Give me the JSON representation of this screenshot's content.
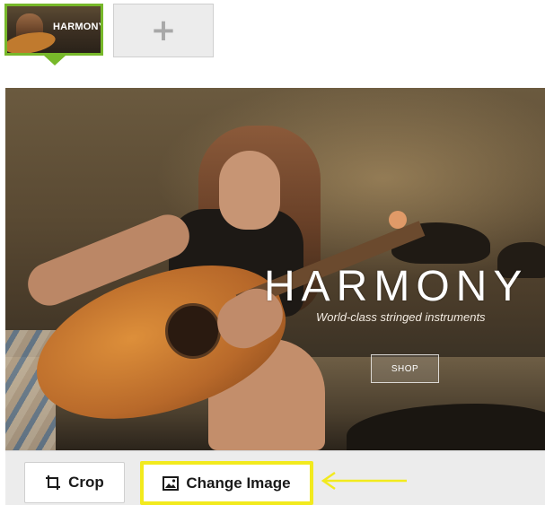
{
  "thumbnails": [
    {
      "title": "HARMONY",
      "selected": true
    }
  ],
  "add_slide": {
    "icon": "plus-icon",
    "label": "+"
  },
  "hero": {
    "brand": "HARMONY",
    "tagline": "World-class stringed instruments",
    "cta_label": "SHOP"
  },
  "toolbar": {
    "crop": {
      "icon": "crop-icon",
      "label": "Crop"
    },
    "change_image": {
      "icon": "image-icon",
      "label": "Change Image"
    }
  },
  "annotation": {
    "icon": "arrow-left-icon",
    "color": "#f2ea1e"
  },
  "colors": {
    "selected_border": "#77b82a",
    "highlight": "#f2ea1e",
    "toolbar_bg": "#ececec"
  }
}
